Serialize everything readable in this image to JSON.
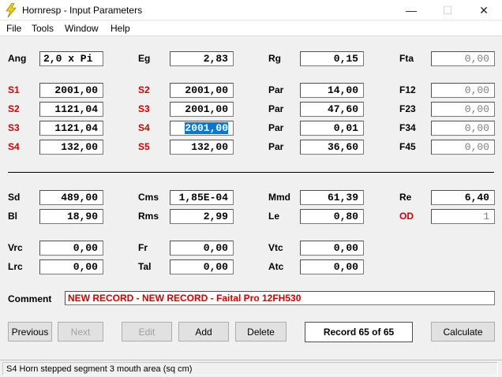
{
  "window": {
    "title": "Hornresp - Input Parameters",
    "app_icon": "lightning-bolt-icon",
    "minimize": "—",
    "maximize": "☐",
    "close": "✕"
  },
  "menu": [
    {
      "label": "File"
    },
    {
      "label": "Tools"
    },
    {
      "label": "Window"
    },
    {
      "label": "Help"
    }
  ],
  "params": {
    "ang": {
      "label": "Ang",
      "value": "2,0 x Pi"
    },
    "eg": {
      "label": "Eg",
      "value": "2,83"
    },
    "rg": {
      "label": "Rg",
      "value": "0,15"
    },
    "fta": {
      "label": "Fta",
      "value": "0,00"
    },
    "row_s1": {
      "label": "S1",
      "value": "2001,00"
    },
    "row_s2a": {
      "label": "S2",
      "value": "2001,00"
    },
    "par1": {
      "label": "Par",
      "value": "14,00"
    },
    "f12": {
      "label": "F12",
      "value": "0,00"
    },
    "row_s2": {
      "label": "S2",
      "value": "1121,04"
    },
    "row_s3a": {
      "label": "S3",
      "value": "2001,00"
    },
    "par2": {
      "label": "Par",
      "value": "47,60"
    },
    "f23": {
      "label": "F23",
      "value": "0,00"
    },
    "row_s3": {
      "label": "S3",
      "value": "1121,04"
    },
    "row_s4a": {
      "label": "S4",
      "value": "2001,00"
    },
    "par3": {
      "label": "Par",
      "value": "0,01"
    },
    "f34": {
      "label": "F34",
      "value": "0,00"
    },
    "row_s4": {
      "label": "S4",
      "value": "132,00"
    },
    "row_s5a": {
      "label": "S5",
      "value": "132,00"
    },
    "par4": {
      "label": "Par",
      "value": "36,60"
    },
    "f45": {
      "label": "F45",
      "value": "0,00"
    },
    "sd": {
      "label": "Sd",
      "value": "489,00"
    },
    "cms": {
      "label": "Cms",
      "value": "1,85E-04"
    },
    "mmd": {
      "label": "Mmd",
      "value": "61,39"
    },
    "re": {
      "label": "Re",
      "value": "6,40"
    },
    "bl": {
      "label": "Bl",
      "value": "18,90"
    },
    "rms": {
      "label": "Rms",
      "value": "2,99"
    },
    "le": {
      "label": "Le",
      "value": "0,80"
    },
    "od": {
      "label": "OD",
      "value": "1"
    },
    "vrc": {
      "label": "Vrc",
      "value": "0,00"
    },
    "fr": {
      "label": "Fr",
      "value": "0,00"
    },
    "vtc": {
      "label": "Vtc",
      "value": "0,00"
    },
    "lrc": {
      "label": "Lrc",
      "value": "0,00"
    },
    "tal": {
      "label": "Tal",
      "value": "0,00"
    },
    "atc": {
      "label": "Atc",
      "value": "0,00"
    }
  },
  "comment": {
    "label": "Comment",
    "value": "NEW RECORD - NEW RECORD - Faital Pro 12FH530"
  },
  "buttons": {
    "previous": "Previous",
    "next": "Next",
    "edit": "Edit",
    "add": "Add",
    "delete": "Delete",
    "calculate": "Calculate"
  },
  "record": "Record 65 of 65",
  "status": "S4    Horn stepped segment 3 mouth area  (sq cm)",
  "colors": {
    "red_label": "#cc0000",
    "selection": "#0078d7"
  }
}
